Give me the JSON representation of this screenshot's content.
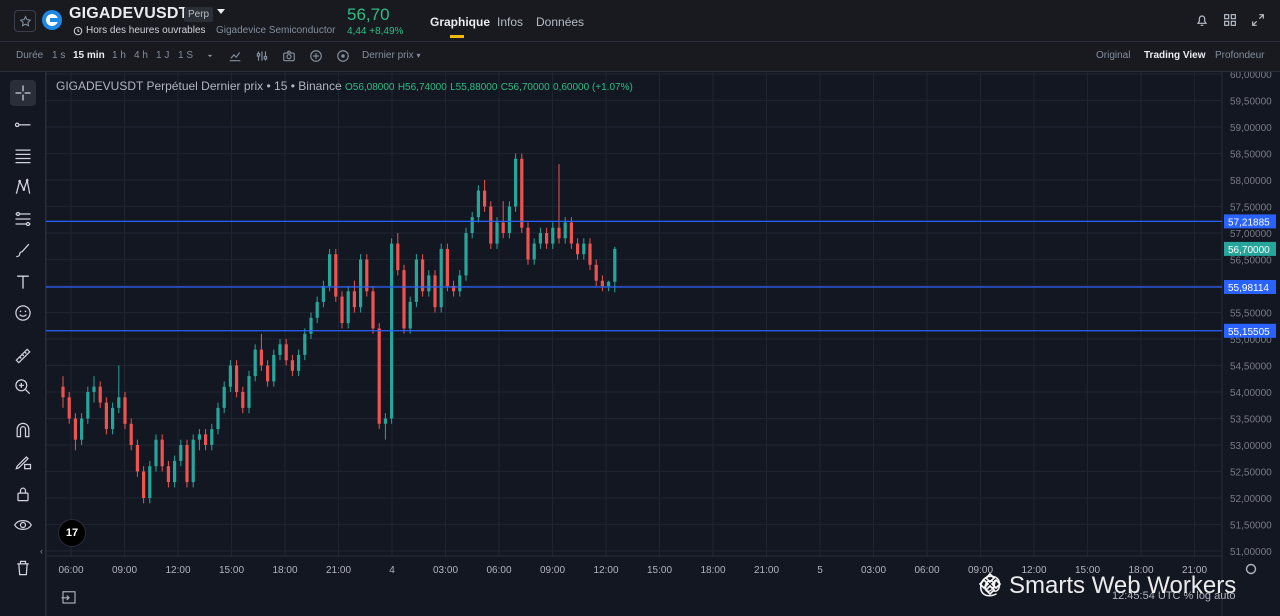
{
  "header": {
    "symbol": "GIGADEVUSDT",
    "badge": "Perp",
    "hours_status": "Hors des heures ouvrables",
    "company": "Gigadevice Semiconductor",
    "price": "56,70",
    "change": "4,44 +8,49%",
    "tabs": [
      {
        "label": "Graphique",
        "active": true
      },
      {
        "label": "Infos",
        "active": false
      },
      {
        "label": "Données",
        "active": false
      }
    ],
    "icons": [
      "favorite-star-icon",
      "bell-icon",
      "grid-layout-icon",
      "expand-icon"
    ]
  },
  "toolbar": {
    "duration_label": "Durée",
    "intervals": [
      {
        "label": "1 s",
        "active": false
      },
      {
        "label": "15 min",
        "active": true
      },
      {
        "label": "1 h",
        "active": false
      },
      {
        "label": "4 h",
        "active": false
      },
      {
        "label": "1 J",
        "active": false
      },
      {
        "label": "1 S",
        "active": false
      }
    ],
    "price_source": "Dernier prix",
    "views": [
      {
        "label": "Original",
        "active": false
      },
      {
        "label": "Trading View",
        "active": true
      },
      {
        "label": "Profondeur",
        "active": false
      }
    ]
  },
  "left_tools": [
    "crosshair-icon",
    "trend-line-icon",
    "horizontal-lines-icon",
    "pattern-icon",
    "fib-icon",
    "brush-icon",
    "text-icon",
    "emoji-icon",
    "ruler-icon",
    "zoom-in-icon",
    "magnet-icon",
    "lock-draw-icon",
    "lock-icon",
    "eye-icon",
    "trash-icon",
    "collapse-icon"
  ],
  "chart": {
    "legend_title": "GIGADEVUSDT Perpétuel Dernier prix • 15 • Binance",
    "open": "O56,08000",
    "high": "H56,74000",
    "low": "L55,88000",
    "close": "C56,70000",
    "change": "0,60000 (+1.07%)",
    "tv_logo": "17",
    "watermark": "@ Smarts Web Workers",
    "status_text": "12:45:54 UTC  %  log  auto",
    "colors": {
      "up": "#26a69a",
      "down": "#ef5350",
      "line": "#2962ff",
      "grid": "#1f2431",
      "bg": "#131722"
    }
  },
  "chart_data": {
    "type": "candlestick",
    "interval": "15 min",
    "y_axis_ticks": [
      "60,00000",
      "59,50000",
      "59,00000",
      "58,50000",
      "58,00000",
      "57,50000",
      "57,00000",
      "56,50000",
      "56,00000",
      "55,50000",
      "55,00000",
      "54,50000",
      "54,00000",
      "53,50000",
      "53,00000",
      "52,50000",
      "52,00000",
      "51,50000",
      "51,00000"
    ],
    "x_axis_ticks": [
      "06:00",
      "09:00",
      "12:00",
      "15:00",
      "18:00",
      "21:00",
      "4",
      "03:00",
      "06:00",
      "09:00",
      "12:00",
      "15:00",
      "18:00",
      "21:00",
      "5",
      "03:00",
      "06:00",
      "09:00",
      "12:00",
      "15:00",
      "18:00",
      "21:00"
    ],
    "ylim": [
      50.8,
      60.0
    ],
    "horizontal_lines": [
      {
        "value": 57.21885,
        "label": "57,21885"
      },
      {
        "value": 55.98114,
        "label": "55,98114"
      },
      {
        "value": 55.15505,
        "label": "55,15505"
      }
    ],
    "last_price": {
      "value": 56.7,
      "label": "56,70000"
    },
    "candles": [
      [
        54.1,
        54.3,
        53.7,
        53.9
      ],
      [
        53.9,
        54.0,
        53.4,
        53.5
      ],
      [
        53.5,
        53.6,
        52.9,
        53.1
      ],
      [
        53.1,
        53.6,
        53.0,
        53.5
      ],
      [
        53.5,
        54.1,
        53.4,
        54.0
      ],
      [
        54.0,
        54.3,
        53.8,
        54.1
      ],
      [
        54.1,
        54.2,
        53.7,
        53.8
      ],
      [
        53.8,
        53.9,
        53.2,
        53.3
      ],
      [
        53.3,
        53.8,
        53.2,
        53.7
      ],
      [
        53.7,
        54.5,
        53.6,
        53.9
      ],
      [
        53.9,
        54.0,
        53.3,
        53.4
      ],
      [
        53.4,
        53.5,
        52.9,
        53.0
      ],
      [
        53.0,
        53.1,
        52.4,
        52.5
      ],
      [
        52.5,
        52.6,
        51.9,
        52.0
      ],
      [
        52.0,
        52.7,
        51.9,
        52.6
      ],
      [
        52.6,
        53.2,
        52.5,
        53.1
      ],
      [
        53.1,
        53.2,
        52.5,
        52.6
      ],
      [
        52.6,
        52.7,
        52.2,
        52.3
      ],
      [
        52.3,
        52.8,
        52.2,
        52.7
      ],
      [
        52.7,
        53.1,
        52.6,
        53.0
      ],
      [
        53.0,
        53.1,
        52.2,
        52.3
      ],
      [
        52.3,
        53.2,
        52.2,
        53.1
      ],
      [
        53.1,
        53.3,
        52.9,
        53.2
      ],
      [
        53.2,
        53.3,
        52.9,
        53.0
      ],
      [
        53.0,
        53.4,
        52.9,
        53.3
      ],
      [
        53.3,
        53.8,
        53.2,
        53.7
      ],
      [
        53.7,
        54.2,
        53.6,
        54.1
      ],
      [
        54.1,
        54.6,
        54.0,
        54.5
      ],
      [
        54.5,
        54.6,
        53.9,
        54.0
      ],
      [
        54.0,
        54.1,
        53.6,
        53.7
      ],
      [
        53.7,
        54.4,
        53.6,
        54.3
      ],
      [
        54.3,
        54.9,
        54.2,
        54.8
      ],
      [
        54.8,
        55.1,
        54.4,
        54.5
      ],
      [
        54.5,
        54.6,
        54.1,
        54.2
      ],
      [
        54.2,
        54.8,
        54.1,
        54.7
      ],
      [
        54.7,
        55.0,
        54.6,
        54.9
      ],
      [
        54.9,
        55.0,
        54.5,
        54.6
      ],
      [
        54.6,
        54.7,
        54.3,
        54.4
      ],
      [
        54.4,
        54.8,
        54.3,
        54.7
      ],
      [
        54.7,
        55.2,
        54.6,
        55.1
      ],
      [
        55.1,
        55.5,
        55.0,
        55.4
      ],
      [
        55.4,
        55.8,
        55.3,
        55.7
      ],
      [
        55.7,
        56.1,
        55.6,
        56.0
      ],
      [
        56.0,
        56.7,
        55.9,
        56.6
      ],
      [
        56.6,
        56.7,
        55.7,
        55.8
      ],
      [
        55.8,
        55.9,
        55.2,
        55.3
      ],
      [
        55.3,
        56.0,
        55.2,
        55.9
      ],
      [
        55.9,
        56.1,
        55.5,
        55.6
      ],
      [
        55.6,
        56.6,
        55.5,
        56.5
      ],
      [
        56.5,
        56.6,
        55.8,
        55.9
      ],
      [
        55.9,
        56.0,
        55.1,
        55.2
      ],
      [
        55.2,
        55.3,
        53.3,
        53.4
      ],
      [
        53.4,
        53.6,
        53.1,
        53.5
      ],
      [
        53.5,
        56.9,
        53.4,
        56.8
      ],
      [
        56.8,
        57.0,
        56.2,
        56.3
      ],
      [
        56.3,
        56.4,
        55.1,
        55.2
      ],
      [
        55.2,
        55.8,
        55.1,
        55.7
      ],
      [
        55.7,
        56.6,
        55.6,
        56.5
      ],
      [
        56.5,
        56.6,
        55.8,
        55.9
      ],
      [
        55.9,
        56.3,
        55.8,
        56.2
      ],
      [
        56.2,
        56.3,
        55.5,
        55.6
      ],
      [
        55.6,
        56.8,
        55.5,
        56.7
      ],
      [
        56.7,
        56.8,
        55.9,
        56.0
      ],
      [
        56.0,
        56.1,
        55.8,
        55.9
      ],
      [
        55.9,
        56.3,
        55.8,
        56.2
      ],
      [
        56.2,
        57.1,
        56.1,
        57.0
      ],
      [
        57.0,
        57.4,
        56.9,
        57.3
      ],
      [
        57.3,
        57.9,
        57.2,
        57.8
      ],
      [
        57.8,
        58.0,
        57.4,
        57.5
      ],
      [
        57.5,
        57.6,
        56.7,
        56.8
      ],
      [
        56.8,
        57.3,
        56.7,
        57.2
      ],
      [
        57.2,
        57.6,
        56.9,
        57.0
      ],
      [
        57.0,
        57.6,
        56.9,
        57.5
      ],
      [
        57.5,
        58.5,
        57.4,
        58.4
      ],
      [
        58.4,
        58.5,
        57.0,
        57.1
      ],
      [
        57.1,
        57.2,
        56.4,
        56.5
      ],
      [
        56.5,
        56.9,
        56.4,
        56.8
      ],
      [
        56.8,
        57.1,
        56.7,
        57.0
      ],
      [
        57.0,
        57.1,
        56.7,
        56.8
      ],
      [
        56.8,
        57.2,
        56.7,
        57.1
      ],
      [
        57.1,
        58.3,
        56.8,
        56.9
      ],
      [
        56.9,
        57.3,
        56.8,
        57.2
      ],
      [
        57.2,
        57.3,
        56.7,
        56.8
      ],
      [
        56.8,
        56.9,
        56.5,
        56.6
      ],
      [
        56.6,
        56.9,
        56.5,
        56.8
      ],
      [
        56.8,
        56.9,
        56.3,
        56.4
      ],
      [
        56.4,
        56.5,
        56.0,
        56.1
      ],
      [
        56.1,
        56.2,
        55.9,
        56.0
      ],
      [
        56.0,
        56.1,
        55.9,
        56.08
      ],
      [
        56.08,
        56.74,
        55.88,
        56.7
      ]
    ]
  }
}
